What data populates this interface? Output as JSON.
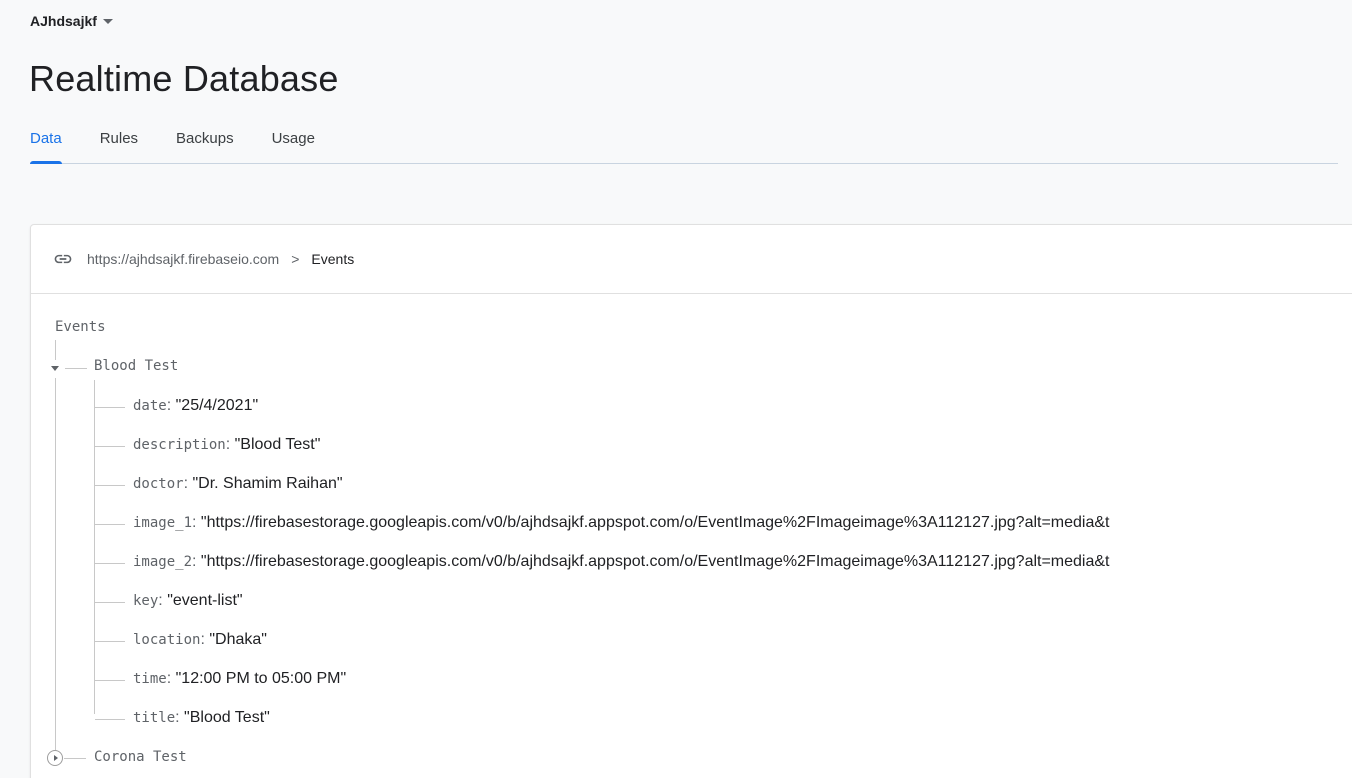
{
  "project": {
    "name": "AJhdsajkf",
    "icon": "caret-down-icon"
  },
  "page_title": "Realtime Database",
  "tabs": [
    {
      "label": "Data",
      "active": true
    },
    {
      "label": "Rules",
      "active": false
    },
    {
      "label": "Backups",
      "active": false
    },
    {
      "label": "Usage",
      "active": false
    }
  ],
  "breadcrumb": {
    "icon": "link-icon",
    "url": "https://ajhdsajkf.firebaseio.com",
    "separator": ">",
    "current": "Events"
  },
  "tree": {
    "root": "Events",
    "expanded_node": {
      "key": "Blood Test",
      "children": [
        {
          "key": "date",
          "value": "\"25/4/2021\""
        },
        {
          "key": "description",
          "value": "\"Blood Test\""
        },
        {
          "key": "doctor",
          "value": "\"Dr. Shamim Raihan\""
        },
        {
          "key": "image_1",
          "value": "\"https://firebasestorage.googleapis.com/v0/b/ajhdsajkf.appspot.com/o/EventImage%2FImageimage%3A112127.jpg?alt=media&t"
        },
        {
          "key": "image_2",
          "value": "\"https://firebasestorage.googleapis.com/v0/b/ajhdsajkf.appspot.com/o/EventImage%2FImageimage%3A112127.jpg?alt=media&t"
        },
        {
          "key": "key",
          "value": "\"event-list\""
        },
        {
          "key": "location",
          "value": "\"Dhaka\""
        },
        {
          "key": "time",
          "value": "\"12:00 PM to 05:00 PM\""
        },
        {
          "key": "title",
          "value": "\"Blood Test\""
        }
      ]
    },
    "collapsed_node": {
      "key": "Corona Test"
    }
  },
  "colors": {
    "accent": "#1a73e8",
    "text": "#202124",
    "muted": "#5f6368",
    "tree_line": "#c8c8c8"
  }
}
